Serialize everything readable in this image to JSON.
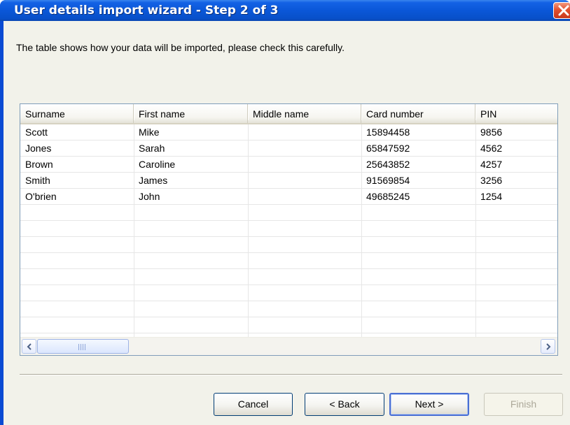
{
  "window": {
    "title": "User details import wizard - Step 2 of 3"
  },
  "instruction": "The table shows how your data will be imported, please check this carefully.",
  "table": {
    "columns": [
      "Surname",
      "First name",
      "Middle name",
      "Card number",
      "PIN"
    ],
    "rows": [
      [
        "Scott",
        "Mike",
        "",
        "15894458",
        "9856"
      ],
      [
        "Jones",
        "Sarah",
        "",
        "65847592",
        "4562"
      ],
      [
        "Brown",
        "Caroline",
        "",
        "25643852",
        "4257"
      ],
      [
        "Smith",
        "James",
        "",
        "91569854",
        "3256"
      ],
      [
        "O'brien",
        "John",
        "",
        "49685245",
        "1254"
      ]
    ]
  },
  "buttons": {
    "cancel": "Cancel",
    "back": "< Back",
    "next": "Next >",
    "finish": "Finish"
  },
  "icons": {
    "close": "close-icon",
    "scroll_left": "chevron-left-icon",
    "scroll_right": "chevron-right-icon"
  },
  "colors": {
    "titlebar": "#0a57d8",
    "close_button": "#e2502f",
    "client_bg": "#f2f2ea",
    "default_button_border": "#4a6fd4"
  }
}
